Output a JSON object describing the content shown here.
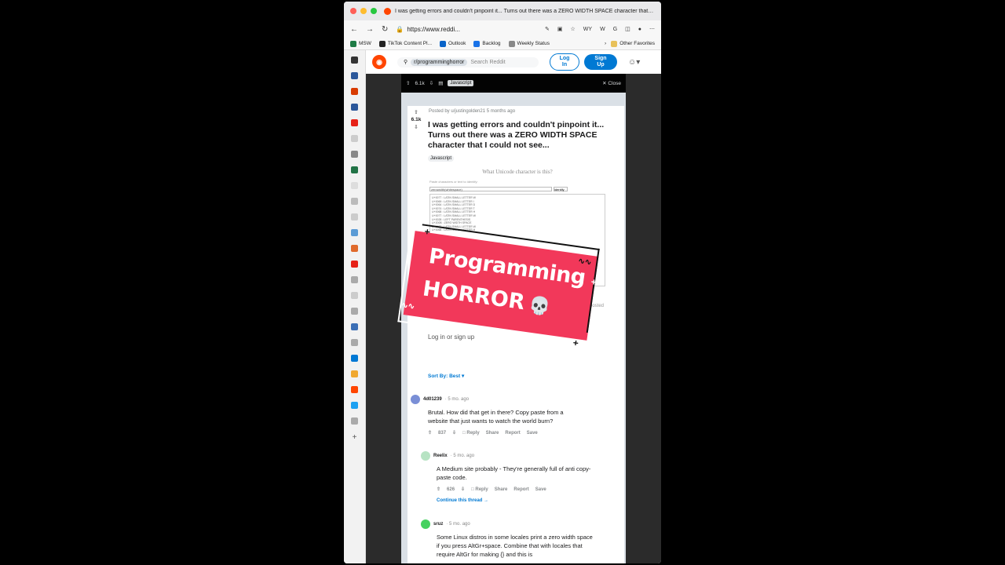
{
  "browser": {
    "tab_title": "I was getting errors and couldn't pinpoint it... Turns out there was a ZERO WIDTH SPACE character that I...",
    "url": "https://www.reddi...",
    "addr_icons": [
      "WY",
      "W",
      "G"
    ],
    "favorites": [
      {
        "label": "MSW",
        "color": "#1e7b45"
      },
      {
        "label": "TikTok Content Pl...",
        "color": "#222222"
      },
      {
        "label": "Outlook",
        "color": "#0a64c8"
      },
      {
        "label": "Backlog",
        "color": "#1a73e8"
      },
      {
        "label": "Weekly Status",
        "color": "#888888"
      }
    ],
    "other_favorites": "Other Favorites"
  },
  "reddit": {
    "subreddit": "r/programminghorror",
    "search_placeholder": "Search Reddit",
    "login": "Log In",
    "signup": "Sign Up"
  },
  "postbar": {
    "votes": "6.1k",
    "flair": "Javascript",
    "close": "Close"
  },
  "post": {
    "votes": "6.1k",
    "meta": "Posted by u/justingolden21 5 months ago",
    "title": "I was getting errors and couldn't pinpoint it... Turns out there was a ZERO WIDTH SPACE character that I could not see...",
    "flair": "Javascript",
    "screenshot_title": "What Unicode character is this?",
    "screenshot_sub": "Paste characters or text to identify:",
    "screenshot_field": "zerowidth(whitespace)",
    "screenshot_btn": "identify",
    "screenshot_rows": [
      "U+0077 : LATIN SMALL LETTER W",
      "U+0069 : LATIN SMALL LETTER I",
      "U+0064 : LATIN SMALL LETTER D",
      "U+0074 : LATIN SMALL LETTER T",
      "U+0068 : LATIN SMALL LETTER H",
      "U+0077 : LATIN SMALL LETTER W",
      "U+0028 : LEFT PARENTHESIS",
      "U+200B : ZERO WIDTH SPACE",
      "U+0077 : LATIN SMALL LETTER W",
      "U+0068 : LATIN SMALL LETTER H"
    ],
    "posted_tag": "posted",
    "login_prompt": "Log in or sign up",
    "sort": "Sort By: Best"
  },
  "comments": [
    {
      "user": "4d01239",
      "time": "5 mo. ago",
      "body": "Brutal. How did that get in there? Copy paste from a website that just wants to watch the world burn?",
      "votes": "837",
      "actions": [
        "Reply",
        "Share",
        "Report",
        "Save"
      ],
      "avatar_color": "#7a8fd6"
    },
    {
      "user": "Reelix",
      "time": "5 mo. ago",
      "body": "A Medium site probably - They're generally full of anti copy-paste code.",
      "votes": "626",
      "actions": [
        "Reply",
        "Share",
        "Report",
        "Save"
      ],
      "thread_link": "Continue this thread →",
      "avatar_color": "#b7e3c3"
    },
    {
      "user": "sruz",
      "time": "5 mo. ago",
      "body": "Some Linux distros in some locales print a zero width space if you press AltGr+space. Combine that with locales that require AltGr for making {} and this is",
      "avatar_color": "#46d160"
    }
  ],
  "sticker": {
    "line1": "Programming",
    "line2": "HORROR",
    "emoji": "💀",
    "bg_color": "#f2385a"
  }
}
